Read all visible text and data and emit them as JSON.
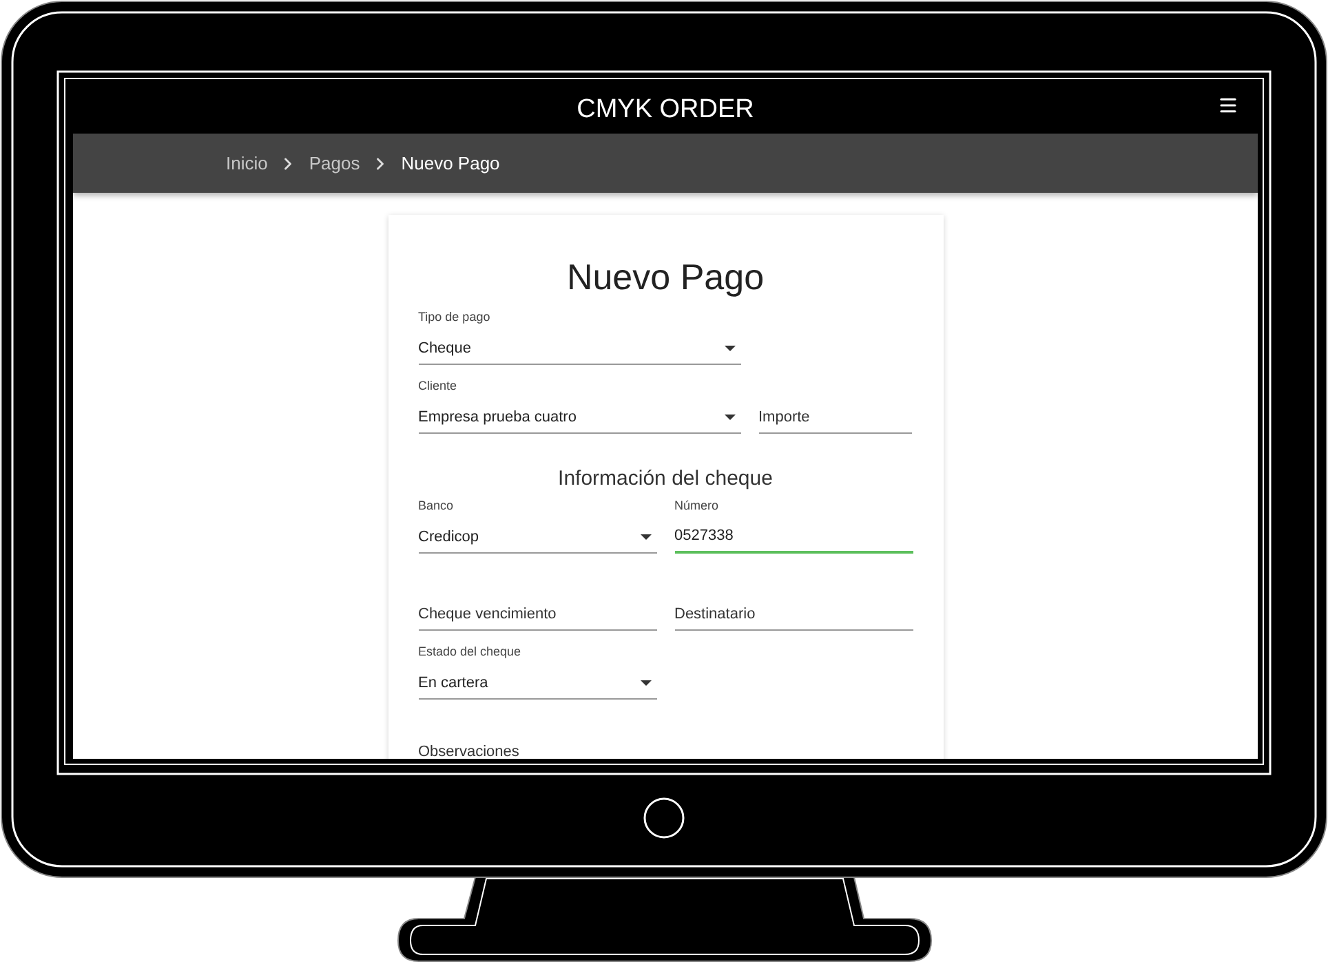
{
  "header": {
    "title": "CMYK ORDER"
  },
  "breadcrumb": [
    {
      "label": "Inicio",
      "current": false
    },
    {
      "label": "Pagos",
      "current": false
    },
    {
      "label": "Nuevo Pago",
      "current": true
    }
  ],
  "form": {
    "title": "Nuevo Pago",
    "rows": [
      {
        "kind": "wide",
        "fields": [
          {
            "kind": "select",
            "label": "Tipo de pago",
            "value": "Cheque",
            "focused": false
          }
        ]
      },
      {
        "kind": "wide",
        "fields": [
          {
            "kind": "select",
            "label": "Cliente",
            "value": "Empresa prueba cuatro",
            "focused": false
          },
          {
            "kind": "input",
            "placeholder": "Importe",
            "focused": false
          }
        ]
      },
      {
        "kind": "heading",
        "text": "Información del cheque"
      },
      {
        "kind": "half",
        "fields": [
          {
            "kind": "select",
            "label": "Banco",
            "value": "Credicop",
            "focused": false
          },
          {
            "kind": "input",
            "label": "Número",
            "value": "0527338",
            "focused": true
          }
        ]
      },
      {
        "kind": "half",
        "fields": [
          {
            "kind": "input",
            "placeholder": "Cheque vencimiento",
            "focused": false
          },
          {
            "kind": "input",
            "placeholder": "Destinatario",
            "focused": false
          }
        ]
      },
      {
        "kind": "half",
        "fields": [
          {
            "kind": "select",
            "label": "Estado del cheque",
            "value": "En cartera",
            "focused": false
          }
        ]
      },
      {
        "kind": "full",
        "fields": [
          {
            "kind": "input",
            "placeholder": "Observaciones",
            "focused": false
          }
        ]
      }
    ]
  }
}
